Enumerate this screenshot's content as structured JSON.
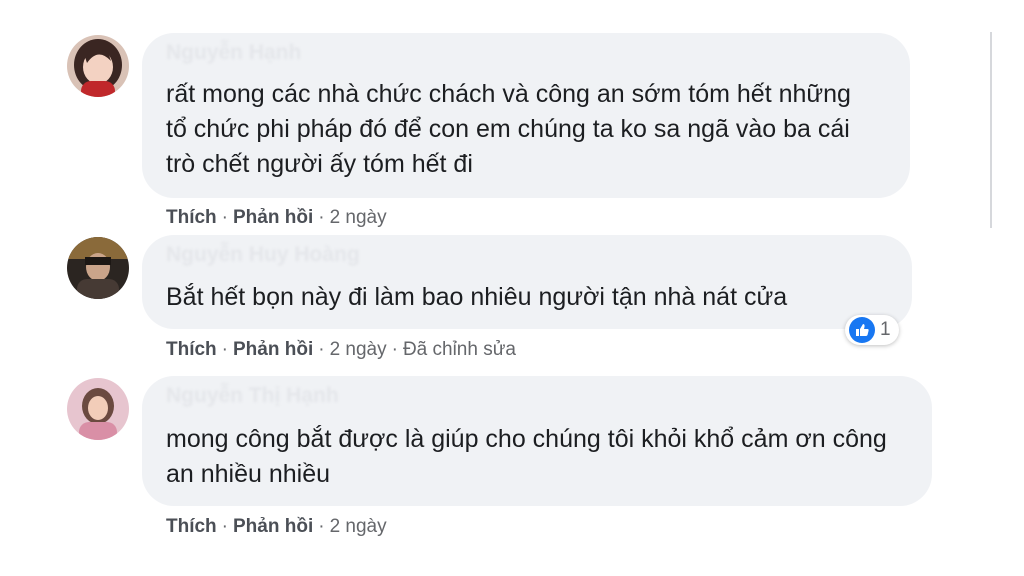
{
  "comments": [
    {
      "author": "Nguyễn Hạnh",
      "text": "rất mong các nhà chức chách và công an sớm tóm hết những tổ chức phi pháp đó để con em chúng ta ko sa ngã vào ba cái trò chết người ấy tóm hết đi",
      "like_label": "Thích",
      "reply_label": "Phản hồi",
      "time": "2 ngày",
      "avatar_icon": "profile-photo"
    },
    {
      "author": "Nguyễn Huy Hoàng",
      "text": "Bắt hết bọn này đi làm bao nhiêu người tận nhà nát cửa",
      "like_label": "Thích",
      "reply_label": "Phản hồi",
      "time": "2 ngày",
      "edited_label": "Đã chỉnh sửa",
      "reaction_count": "1",
      "reaction_icon": "like-icon",
      "avatar_icon": "profile-photo"
    },
    {
      "author": "Nguyễn Thị Hạnh",
      "text": "mong công bắt được là giúp cho chúng tôi khỏi khổ cảm ơn công an nhiều nhiều",
      "like_label": "Thích",
      "reply_label": "Phản hồi",
      "time": "2 ngày",
      "avatar_icon": "profile-photo"
    }
  ],
  "colors": {
    "bubble": "#f0f2f5",
    "text": "#1c1e21",
    "meta": "#65676b",
    "like_blue": "#1877f2"
  }
}
